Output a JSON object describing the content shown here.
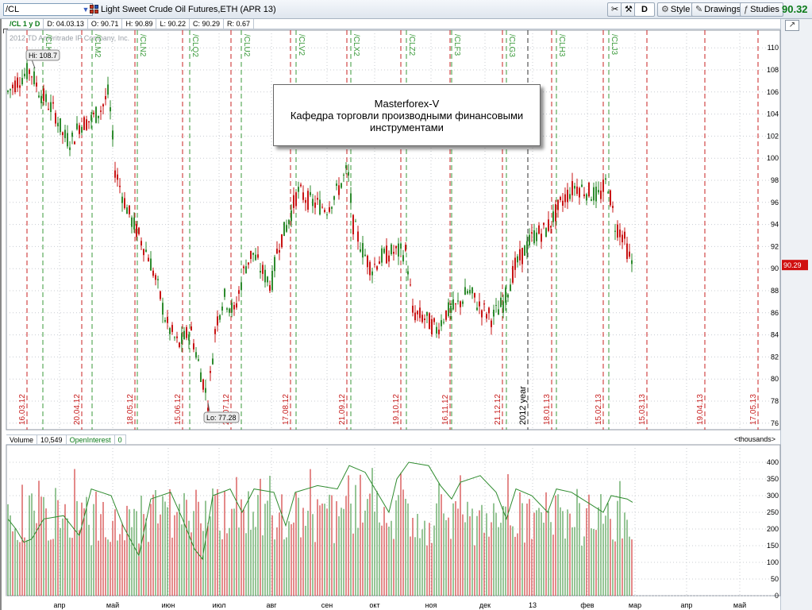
{
  "toolbar": {
    "symbol_value": "/CL",
    "instrument_title": "Light Sweet Crude Oil Futures,ETH (APR 13)",
    "d_label": "D",
    "style_label": "Style",
    "drawings_label": "Drawings",
    "studies_label": "Studies",
    "last_price": "90.32",
    "colors": {
      "price": "#0a7a18"
    }
  },
  "ohlc": {
    "aggregation": "/CL 1 y D",
    "date": "D: 04.03.13",
    "open": "O: 90.71",
    "high": "H: 90.89",
    "low": "L: 90.22",
    "close": "C: 90.29",
    "range": "R: 0.67"
  },
  "watermark": "2012 TD Ameritrade IP Company, Inc.",
  "annotation": {
    "line1": "Masterforex-V",
    "line2": "Кафедра торговли производными финансовыми",
    "line3": "инструментами"
  },
  "price_chart": {
    "hi_label": "Hi: 108.7",
    "lo_label": "Lo: 77.28",
    "current_price_label": "90.29",
    "y_ticks": [
      "110",
      "108",
      "106",
      "104",
      "102",
      "100",
      "98",
      "96",
      "94",
      "92",
      "90",
      "88",
      "86",
      "84",
      "82",
      "80",
      "78",
      "76"
    ],
    "year_marker_label": "2012 year",
    "green_markers": [
      "/CLK2",
      "/CLM2",
      "/CLN2",
      "/CLQ2",
      "/CLU2",
      "/CLV2",
      "/CLX2",
      "/CLZ2",
      "/CLF3",
      "/CLG3",
      "/CLH3",
      "/CLJ3"
    ],
    "red_markers": [
      "16.03.12",
      "20.04.12",
      "18.05.12",
      "15.06.12",
      "20.07.12",
      "17.08.12",
      "21.09.12",
      "19.10.12",
      "16.11.12",
      "21.12.12",
      "18.01.13",
      "15.02.13",
      "15.03.13",
      "19.04.13",
      "17.05.13"
    ],
    "colors": {
      "up": "#2e8b2e",
      "down": "#c81414",
      "price_tag": "#d01010"
    }
  },
  "volume_pane": {
    "volume_label": "Volume",
    "volume_value": "10,549",
    "oi_label": "OpenInterest",
    "oi_value": "0",
    "units_label": "<thousands>",
    "y_ticks": [
      "400",
      "350",
      "300",
      "250",
      "200",
      "150",
      "100",
      "50",
      "0"
    ]
  },
  "x_axis": {
    "month_labels": [
      "апр",
      "май",
      "июн",
      "июл",
      "авг",
      "сен",
      "окт",
      "ноя",
      "дек",
      "13",
      "фев",
      "мар",
      "апр",
      "май"
    ]
  }
}
